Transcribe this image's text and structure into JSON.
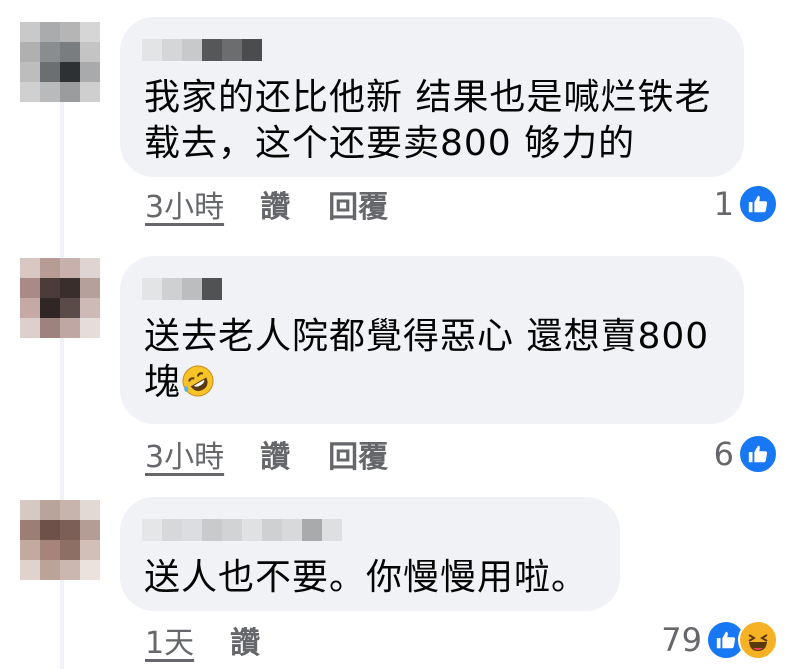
{
  "colors": {
    "bubble": "#f0f2f5",
    "meta_text": "#65676b",
    "like_blue": "#1877f2",
    "haha_yellow": "#f7b125"
  },
  "comments": [
    {
      "text": "我家的还比他新 结果也是喊烂铁老\n载去，这个还要卖800 够力的",
      "time": "3小時",
      "like_label": "讚",
      "reply_label": "回覆",
      "reaction_count": "1",
      "reactions": [
        "like-icon"
      ]
    },
    {
      "text": "送去老人院都覺得惡心 還想賣800\n塊",
      "emoji": "rolling-on-floor-laughing-emoji",
      "time": "3小時",
      "like_label": "讚",
      "reply_label": "回覆",
      "reaction_count": "6",
      "reactions": [
        "like-icon"
      ]
    },
    {
      "text": "送人也不要。你慢慢用啦。",
      "time": "1天",
      "like_label": "讚",
      "reaction_count": "79",
      "reactions": [
        "like-icon",
        "haha-icon"
      ]
    }
  ]
}
